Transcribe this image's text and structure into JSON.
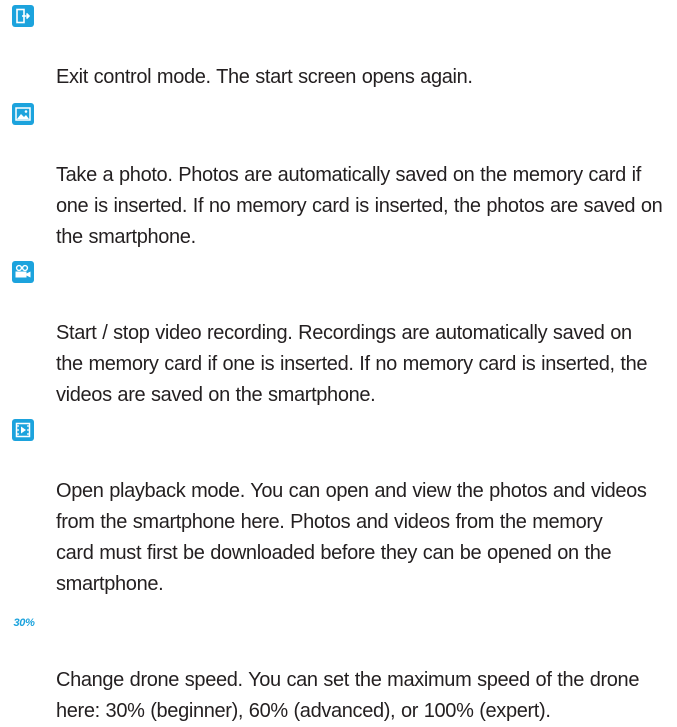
{
  "items": [
    {
      "icon": "exit-icon",
      "text": "Exit control mode. The start screen opens again."
    },
    {
      "icon": "photo-icon",
      "text": "Take a photo. Photos are automatically saved on the memory card if\none is inserted. If no memory card is inserted, the photos are saved on\nthe smartphone."
    },
    {
      "icon": "video-camera-icon",
      "text": "Start / stop video recording. Recordings are automatically saved on\nthe memory card if one is inserted. If no memory card is inserted, the\nvideos are saved on the smartphone."
    },
    {
      "icon": "playback-icon",
      "text": "Open playback mode. You can open and view the photos and videos\nfrom the smartphone here. Photos and videos from the memory\ncard must first be downloaded before they can be opened on the\nsmartphone."
    },
    {
      "icon": "speed-icon",
      "icon_label": "30%",
      "text": "Change drone speed. You can set the maximum speed of the drone\nhere: 30% (beginner), 60% (advanced), or 100% (expert)."
    }
  ],
  "colors": {
    "accent": "#1ca3dd",
    "text": "#231f20"
  }
}
